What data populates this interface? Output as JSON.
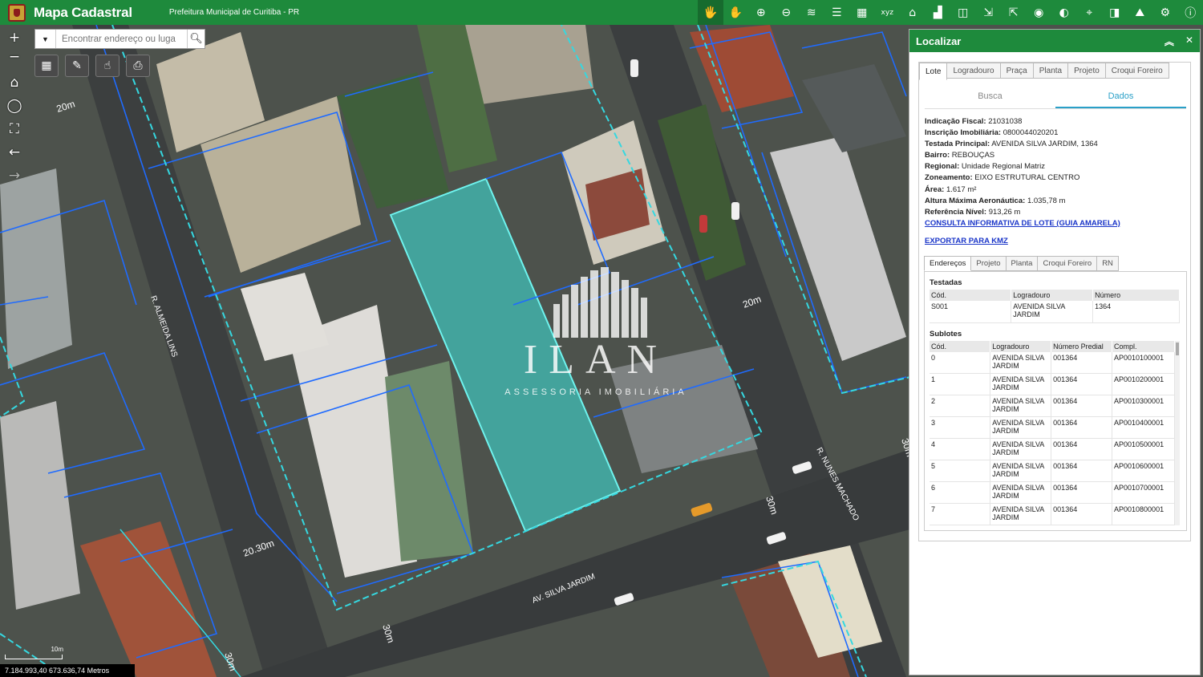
{
  "header": {
    "app_title": "Mapa Cadastral",
    "subtitle": "Prefeitura Municipal de Curitiba - PR",
    "brand_color": "#1e8a3c",
    "tools": [
      {
        "name": "identify-icon",
        "glyph": "🖐"
      },
      {
        "name": "pan-icon",
        "glyph": "✋"
      },
      {
        "name": "zoom-in-icon",
        "glyph": "⊕"
      },
      {
        "name": "zoom-out-icon",
        "glyph": "⊖"
      },
      {
        "name": "layers-icon",
        "glyph": "≋"
      },
      {
        "name": "legend-icon",
        "glyph": "☰"
      },
      {
        "name": "basemap-grid-icon",
        "glyph": "▦"
      },
      {
        "name": "xyz-icon",
        "glyph": "xyz"
      },
      {
        "name": "education-icon",
        "glyph": "⌂"
      },
      {
        "name": "building-icon",
        "glyph": "▟"
      },
      {
        "name": "compare-icon",
        "glyph": "◫"
      },
      {
        "name": "import-icon",
        "glyph": "⇲"
      },
      {
        "name": "export-icon",
        "glyph": "⇱"
      },
      {
        "name": "target-icon",
        "glyph": "◉"
      },
      {
        "name": "globe-icon",
        "glyph": "◐"
      },
      {
        "name": "map-query-icon",
        "glyph": "⌖"
      },
      {
        "name": "swipe-icon",
        "glyph": "◨"
      },
      {
        "name": "terrain-icon",
        "glyph": "⛰"
      },
      {
        "name": "settings-icon",
        "glyph": "⚙"
      },
      {
        "name": "info-icon",
        "glyph": "ⓘ"
      }
    ]
  },
  "map": {
    "search_placeholder": "Encontrar endereço ou luga",
    "street_labels": [
      "R. ALMEIDA LINS",
      "R. NUNES MACHADO",
      "AV. SILVA JARDIM"
    ],
    "dimension_labels": [
      "20m",
      "20m",
      "20.30m",
      "30m",
      "30m",
      "30m",
      "30m"
    ],
    "watermark_brand": "ILAN",
    "watermark_tagline": "ASSESSORIA IMOBILIÁRIA",
    "scale_label": "10m",
    "coordinates": "7.184.993,40 673.636,74 Metros",
    "selected_fill": "#3ecfc8",
    "parcel_line": "#1f6bff"
  },
  "panel": {
    "title": "Localizar",
    "tabs": [
      "Lote",
      "Logradouro",
      "Praça",
      "Planta",
      "Projeto",
      "Croqui Foreiro"
    ],
    "subtabs": [
      "Busca",
      "Dados"
    ],
    "fields": [
      {
        "k": "Indicação Fiscal:",
        "v": "21031038"
      },
      {
        "k": "Inscrição Imobiliária:",
        "v": "0800044020201"
      },
      {
        "k": "Testada Principal:",
        "v": "AVENIDA SILVA JARDIM, 1364"
      },
      {
        "k": "Bairro:",
        "v": "REBOUÇAS"
      },
      {
        "k": "Regional:",
        "v": "Unidade Regional Matriz"
      },
      {
        "k": "Zoneamento:",
        "v": "EIXO ESTRUTURAL CENTRO"
      },
      {
        "k": "Área:",
        "v": "1.617 m²"
      },
      {
        "k": "Altura Máxima Aeronáutica:",
        "v": "1.035,78 m"
      },
      {
        "k": "Referência Nível:",
        "v": "913,26 m"
      }
    ],
    "link_guide": "CONSULTA INFORMATIVA DE LOTE (GUIA AMARELA)",
    "link_kmz": "EXPORTAR PARA KMZ",
    "detail_tabs": [
      "Endereços",
      "Projeto",
      "Planta",
      "Croqui Foreiro",
      "RN"
    ],
    "testadas_title": "Testadas",
    "testadas_headers": [
      "Cód.",
      "Logradouro",
      "Número"
    ],
    "testadas_rows": [
      [
        "S001",
        "AVENIDA SILVA JARDIM",
        "1364"
      ]
    ],
    "sublotes_title": "Sublotes",
    "sublotes_headers": [
      "Cód.",
      "Logradouro",
      "Número Predial",
      "Compl."
    ],
    "sublotes_rows": [
      [
        "0",
        "AVENIDA SILVA JARDIM",
        "001364",
        "AP0010100001"
      ],
      [
        "1",
        "AVENIDA SILVA JARDIM",
        "001364",
        "AP0010200001"
      ],
      [
        "2",
        "AVENIDA SILVA JARDIM",
        "001364",
        "AP0010300001"
      ],
      [
        "3",
        "AVENIDA SILVA JARDIM",
        "001364",
        "AP0010400001"
      ],
      [
        "4",
        "AVENIDA SILVA JARDIM",
        "001364",
        "AP0010500001"
      ],
      [
        "5",
        "AVENIDA SILVA JARDIM",
        "001364",
        "AP0010600001"
      ],
      [
        "6",
        "AVENIDA SILVA JARDIM",
        "001364",
        "AP0010700001"
      ],
      [
        "7",
        "AVENIDA SILVA JARDIM",
        "001364",
        "AP0010800001"
      ]
    ]
  }
}
